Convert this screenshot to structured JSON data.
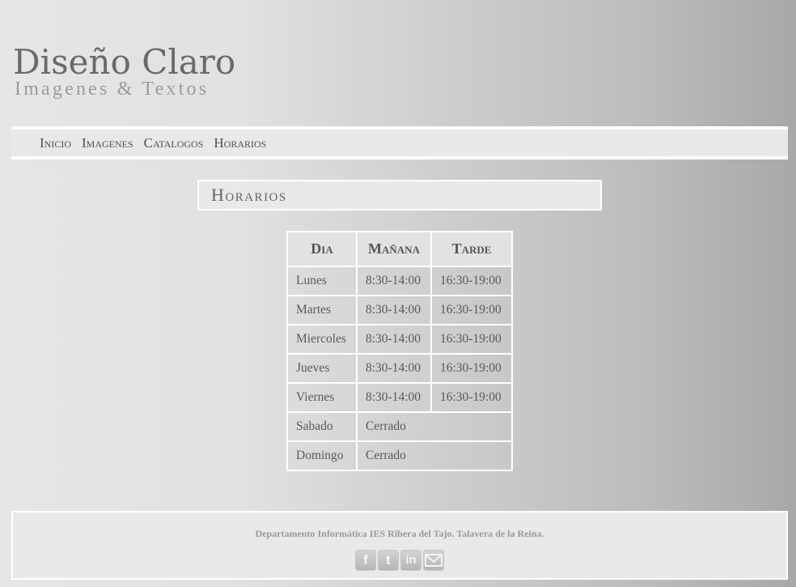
{
  "brand": {
    "title": "Diseño Claro",
    "subtitle": "Imagenes & Textos"
  },
  "nav": {
    "items": [
      {
        "label": "Inicio"
      },
      {
        "label": "Imagenes"
      },
      {
        "label": "Catalogos"
      },
      {
        "label": "Horarios"
      }
    ]
  },
  "section": {
    "title": "Horarios"
  },
  "schedule": {
    "headers": [
      "Dia",
      "Mañana",
      "Tarde"
    ],
    "rows": [
      {
        "day": "Lunes",
        "morning": "8:30-14:00",
        "afternoon": "16:30-19:00"
      },
      {
        "day": "Martes",
        "morning": "8:30-14:00",
        "afternoon": "16:30-19:00"
      },
      {
        "day": "Miercoles",
        "morning": "8:30-14:00",
        "afternoon": "16:30-19:00"
      },
      {
        "day": "Jueves",
        "morning": "8:30-14:00",
        "afternoon": "16:30-19:00"
      },
      {
        "day": "Viernes",
        "morning": "8:30-14:00",
        "afternoon": "16:30-19:00"
      },
      {
        "day": "Sabado",
        "closed": "Cerrado"
      },
      {
        "day": "Domingo",
        "closed": "Cerrado"
      }
    ]
  },
  "footer": {
    "text": "Departamento Informática IES Ribera del Tajo. Talavera de la Reina.",
    "social": [
      {
        "icon": "facebook-icon",
        "glyph": "f"
      },
      {
        "icon": "twitter-icon",
        "glyph": "t"
      },
      {
        "icon": "linkedin-icon",
        "glyph": "in"
      },
      {
        "icon": "email-icon",
        "glyph": ""
      }
    ]
  },
  "colors": {
    "panel": "#e9e9e9",
    "border": "#ffffff",
    "text": "#555555"
  }
}
